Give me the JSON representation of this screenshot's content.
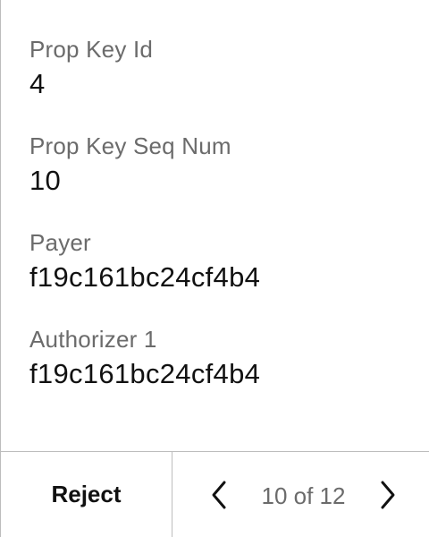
{
  "fields": [
    {
      "label": "Prop Key Id",
      "value": "4"
    },
    {
      "label": "Prop Key Seq Num",
      "value": "10"
    },
    {
      "label": "Payer",
      "value": "f19c161bc24cf4b4"
    },
    {
      "label": "Authorizer 1",
      "value": "f19c161bc24cf4b4"
    }
  ],
  "footer": {
    "reject_label": "Reject",
    "page_indicator": "10 of 12",
    "prev_icon": "chevron-left-icon",
    "next_icon": "chevron-right-icon"
  },
  "colors": {
    "label": "#6b6b6b",
    "value": "#111111",
    "divider": "#bdbdbd"
  }
}
